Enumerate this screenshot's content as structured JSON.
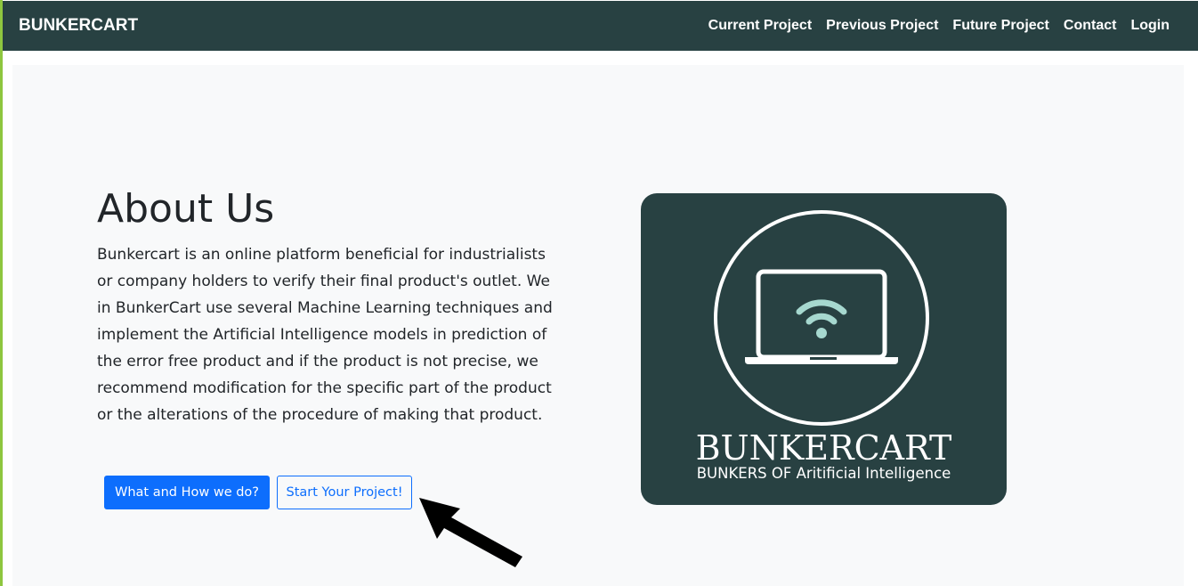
{
  "navbar": {
    "brand": "BUNKERCART",
    "links": [
      {
        "label": "Current Project"
      },
      {
        "label": "Previous Project"
      },
      {
        "label": "Future Project"
      },
      {
        "label": "Contact"
      },
      {
        "label": "Login"
      }
    ]
  },
  "hero": {
    "title": "About Us",
    "description": "Bunkercart is an online platform beneficial for industrialists or company holders to verify their final product's outlet. We in BunkerCart use several Machine Learning techniques and implement the Artificial Intelligence models in prediction of the error free product and if the product is not precise, we recommend modification for the specific part of the product or the alterations of the procedure of making that product.",
    "primary_button": "What and How we do?",
    "secondary_button": "Start Your Project!"
  },
  "logo": {
    "name": "BUNKERCART",
    "tagline": "BUNKERS OF Aritificial Intelligence",
    "icon": "laptop-wifi-icon"
  },
  "colors": {
    "navbar_bg": "#284142",
    "hero_bg": "#f8f9fa",
    "accent": "#0d6efd",
    "logo_bg": "#284142",
    "wifi": "#a6d8cf",
    "left_edge": "#8ec63f"
  }
}
